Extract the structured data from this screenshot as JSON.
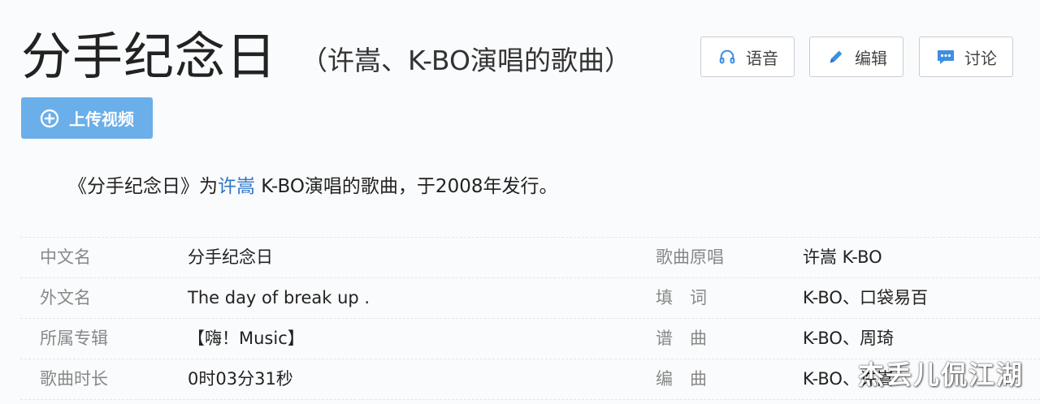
{
  "header": {
    "title": "分手纪念日",
    "subtitle": "（许嵩、K-BO演唱的歌曲）"
  },
  "actions": {
    "voice_label": "语音",
    "edit_label": "编辑",
    "discuss_label": "讨论",
    "voice_icon": "headphones-icon",
    "edit_icon": "pencil-icon",
    "discuss_icon": "chat-bubble-icon"
  },
  "upload": {
    "label": "上传视频",
    "icon": "plus-circle-icon"
  },
  "summary": {
    "before": "《分手纪念日》为",
    "link": "许嵩",
    "after": " K-BO演唱的歌曲，于2008年发行。"
  },
  "info_rows": [
    {
      "k1": "中文名",
      "v1": "分手纪念日",
      "k2": "歌曲原唱",
      "v2": "许嵩 K-BO"
    },
    {
      "k1": "外文名",
      "v1": "The day of break up .",
      "k2": "填　词",
      "v2": "K-BO、口袋易百"
    },
    {
      "k1": "所属专辑",
      "v1": "【嗨！Music】",
      "k2": "谱　曲",
      "v2": "K-BO、周琦"
    },
    {
      "k1": "歌曲时长",
      "v1": "0时03分31秒",
      "k2": "编　曲",
      "v2": "K-BO、许嵩"
    }
  ],
  "watermark": "杰丢儿侃江湖",
  "colors": {
    "accent_link": "#2e76c8",
    "upload_button": "#6aaeea",
    "icon_blue": "#3d8fe0"
  }
}
